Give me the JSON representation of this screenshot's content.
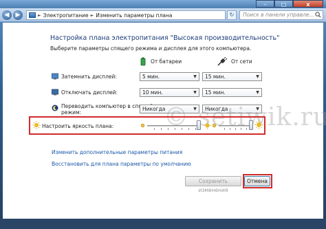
{
  "address": {
    "crumb1": "Электропитание",
    "sep": "►",
    "crumb2": "Изменить параметры плана"
  },
  "search": {
    "placeholder": "Поиск в панели управле..."
  },
  "header": {
    "title": "Настройка плана электропитания \"Высокая производительность\"",
    "subtitle": "Выберите параметры спящего режима и дисплея для этого компьютера."
  },
  "columns": {
    "battery": "От батареи",
    "ac": "От сети"
  },
  "rows": [
    {
      "label": "Затемнить дисплей:",
      "battery": "5 мин.",
      "ac": "15 мин."
    },
    {
      "label": "Отключать дисплей:",
      "battery": "10 мин.",
      "ac": "15 мин."
    },
    {
      "label_line1": "Переводить компьютер в спящий",
      "label_line2": "режим:",
      "battery": "Никогда",
      "ac": "Никогда"
    }
  ],
  "brightness": {
    "label": "Настроить яркость плана:",
    "battery_level": 1.0,
    "ac_level": 1.0
  },
  "watermark": "© setiwik.ru",
  "links": {
    "advanced": "Изменить дополнительные параметры питания",
    "restore": "Восстановить для плана параметры по умолчанию"
  },
  "buttons": {
    "save": "Сохранить изменения",
    "cancel": "Отмена"
  },
  "window": {
    "close": "x",
    "min": "–",
    "max": "□"
  },
  "colors": {
    "highlight": "#d12a2a",
    "link": "#1a57a8",
    "title": "#1b3c78"
  }
}
